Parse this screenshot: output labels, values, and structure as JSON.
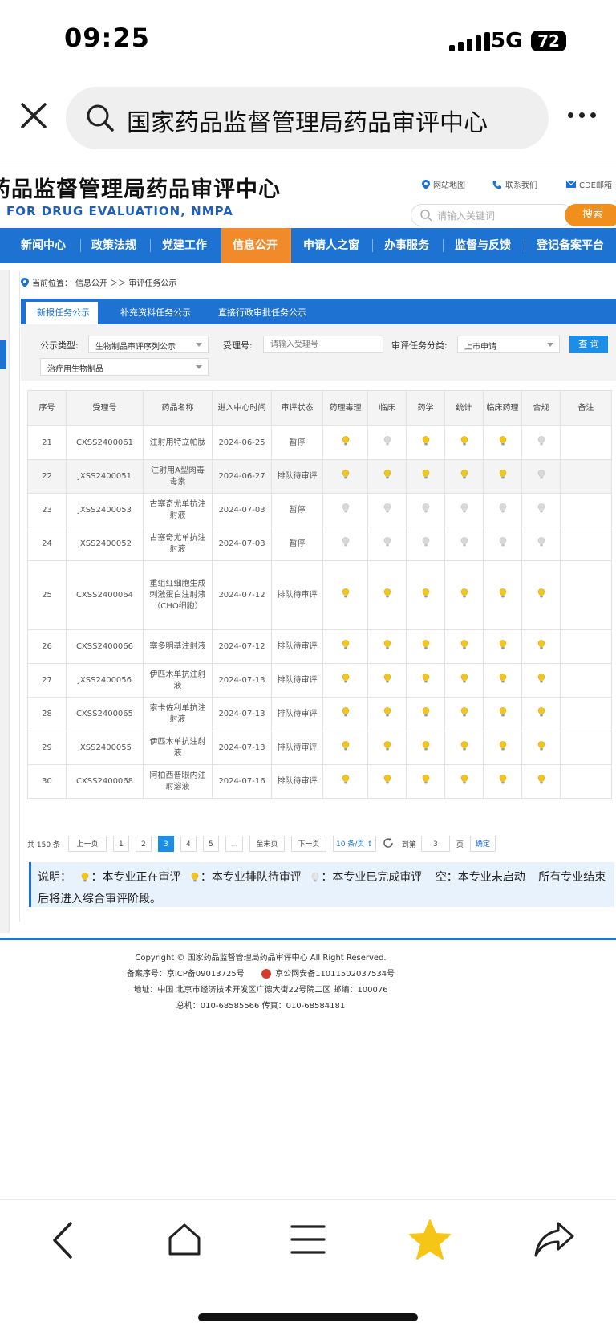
{
  "status_bar": {
    "time": "09:25",
    "network": "5G",
    "battery": "72"
  },
  "browser": {
    "search_text": "国家药品监督管理局药品审评中心"
  },
  "header": {
    "title": "药品监督管理局药品审评中心",
    "subtitle": "FOR DRUG EVALUATION, NMPA",
    "links": [
      "网站地图",
      "联系我们",
      "CDE邮箱"
    ],
    "search_placeholder": "请输入关键词",
    "search_button": "搜索"
  },
  "nav": {
    "items": [
      "新闻中心",
      "政策法规",
      "党建工作",
      "信息公开",
      "申请人之窗",
      "办事服务",
      "监督与反馈",
      "登记备案平台"
    ],
    "active": "信息公开"
  },
  "breadcrumb": {
    "prefix": "当前位置：",
    "path": "信息公开 ＞＞ 审评任务公示"
  },
  "tabs": [
    "新报任务公示",
    "补充资料任务公示",
    "直接行政审批任务公示"
  ],
  "filters": {
    "type_label": "公示类型:",
    "type_value": "生物制品审评序列公示",
    "acceptance_label": "受理号:",
    "acceptance_placeholder": "请输入受理号",
    "category_label": "审评任务分类:",
    "category_value": "上市申请",
    "subtype_value": "治疗用生物制品",
    "query_button": "查 询"
  },
  "table": {
    "headers": [
      "序号",
      "受理号",
      "药品名称",
      "进入中心时间",
      "审评状态",
      "药理毒理",
      "临床",
      "药学",
      "统计",
      "临床药理",
      "合规",
      "备注"
    ],
    "rows": [
      {
        "no": "21",
        "id": "CXSS2400061",
        "name": "注射用特立帕肽",
        "date": "2024-06-25",
        "status": "暂停",
        "bulbs": [
          "active",
          "done",
          "active",
          "active",
          "active",
          "done"
        ]
      },
      {
        "no": "22",
        "id": "JXSS2400051",
        "name": "注射用A型肉毒毒素",
        "date": "2024-06-27",
        "status": "排队待审评",
        "bulbs": [
          "queue",
          "queue",
          "queue",
          "queue",
          "queue",
          "done"
        ]
      },
      {
        "no": "23",
        "id": "JXSS2400053",
        "name": "古塞奇尤单抗注射液",
        "date": "2024-07-03",
        "status": "暂停",
        "bulbs": [
          "done",
          "done",
          "done",
          "done",
          "done",
          "done"
        ]
      },
      {
        "no": "24",
        "id": "JXSS2400052",
        "name": "古塞奇尤单抗注射液",
        "date": "2024-07-03",
        "status": "暂停",
        "bulbs": [
          "done",
          "done",
          "done",
          "done",
          "done",
          "done"
        ]
      },
      {
        "no": "25",
        "id": "CXSS2400064",
        "name": "重组红细胞生成刺激蛋白注射液（CHO细胞）",
        "date": "2024-07-12",
        "status": "排队待审评",
        "bulbs": [
          "queue",
          "queue",
          "queue",
          "queue",
          "queue",
          "queue"
        ]
      },
      {
        "no": "26",
        "id": "CXSS2400066",
        "name": "塞多明基注射液",
        "date": "2024-07-12",
        "status": "排队待审评",
        "bulbs": [
          "queue",
          "queue",
          "queue",
          "queue",
          "queue",
          "queue"
        ]
      },
      {
        "no": "27",
        "id": "JXSS2400056",
        "name": "伊匹木单抗注射液",
        "date": "2024-07-13",
        "status": "排队待审评",
        "bulbs": [
          "queue",
          "queue",
          "queue",
          "queue",
          "queue",
          "queue"
        ]
      },
      {
        "no": "28",
        "id": "CXSS2400065",
        "name": "索卡佐利单抗注射液",
        "date": "2024-07-13",
        "status": "排队待审评",
        "bulbs": [
          "queue",
          "queue",
          "queue",
          "queue",
          "queue",
          "queue"
        ]
      },
      {
        "no": "29",
        "id": "JXSS2400055",
        "name": "伊匹木单抗注射液",
        "date": "2024-07-13",
        "status": "排队待审评",
        "bulbs": [
          "queue",
          "queue",
          "queue",
          "queue",
          "queue",
          "queue"
        ]
      },
      {
        "no": "30",
        "id": "CXSS2400068",
        "name": "阿柏西普眼内注射溶液",
        "date": "2024-07-16",
        "status": "排队待审评",
        "bulbs": [
          "queue",
          "queue",
          "queue",
          "queue",
          "queue",
          "queue"
        ]
      }
    ]
  },
  "pager": {
    "total": "共 150 条",
    "prev": "上一页",
    "pages": [
      "1",
      "2",
      "3",
      "4",
      "5",
      "..."
    ],
    "current": "3",
    "last": "至末页",
    "next": "下一页",
    "per_page": "10 条/页",
    "goto_label": "到第",
    "goto_value": "3",
    "page_unit": "页",
    "confirm": "确定"
  },
  "legend": {
    "lead": "说明：",
    "active": "：本专业正在审评",
    "queue": "：本专业排队待审评",
    "done": "：本专业已完成审评",
    "empty": "空：本专业未启动",
    "tail": "所有专业结束后将进入综合审评阶段。"
  },
  "footer": {
    "copyright": "Copyright © 国家药品监督管理局药品审评中心    All Right Reserved.",
    "icp": "备案序号：京ICP备09013725号",
    "police": "京公网安备11011502037534号",
    "address": "地址：中国 北京市经济技术开发区广德大街22号院二区      邮编：100076",
    "phone": "总机：010-68585566      传真：010-68584181"
  },
  "colors": {
    "brand_blue": "#1d72d2",
    "orange": "#f08a2a",
    "bulb_active": "#f5c518",
    "bulb_queue": "#f5c518",
    "bulb_done": "#d8d8d8"
  }
}
